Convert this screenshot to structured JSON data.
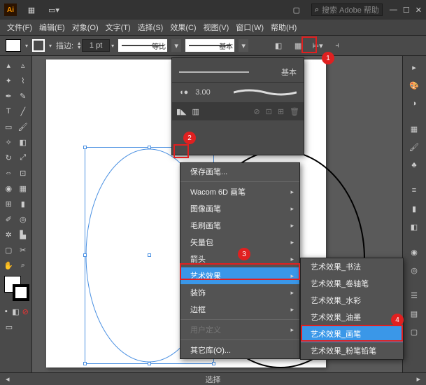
{
  "titlebar": {
    "app_abbrev": "Ai",
    "search_placeholder": "搜索 Adobe 帮助"
  },
  "menubar": {
    "items": [
      "文件(F)",
      "编辑(E)",
      "对象(O)",
      "文字(T)",
      "选择(S)",
      "效果(C)",
      "视图(V)",
      "窗口(W)",
      "帮助(H)"
    ]
  },
  "ctrlbar": {
    "stroke_label": "描边:",
    "stroke_value": "1 pt",
    "profile_label": "等比",
    "brush_label": "基本"
  },
  "brush_panel": {
    "line1_label": "基本",
    "line2_value": "3.00"
  },
  "menu1": {
    "items": [
      {
        "label": "保存画笔...",
        "sub": false
      },
      {
        "label": "Wacom 6D 画笔",
        "sub": true
      },
      {
        "label": "图像画笔",
        "sub": true
      },
      {
        "label": "毛刷画笔",
        "sub": true
      },
      {
        "label": "矢量包",
        "sub": true
      },
      {
        "label": "箭头",
        "sub": true
      },
      {
        "label": "艺术效果",
        "sub": true,
        "hl": true
      },
      {
        "label": "装饰",
        "sub": true
      },
      {
        "label": "边框",
        "sub": true
      },
      {
        "label": "用户定义",
        "sub": true,
        "disabled": true
      },
      {
        "label": "其它库(O)...",
        "sub": false
      }
    ]
  },
  "menu2": {
    "items": [
      {
        "label": "艺术效果_书法"
      },
      {
        "label": "艺术效果_卷轴笔"
      },
      {
        "label": "艺术效果_水彩"
      },
      {
        "label": "艺术效果_油墨"
      },
      {
        "label": "艺术效果_画笔",
        "hl": true
      },
      {
        "label": "艺术效果_粉笔铅笔"
      }
    ]
  },
  "annotations": {
    "a1": "1",
    "a2": "2",
    "a3": "3",
    "a4": "4"
  },
  "status": {
    "mode": "选择"
  }
}
